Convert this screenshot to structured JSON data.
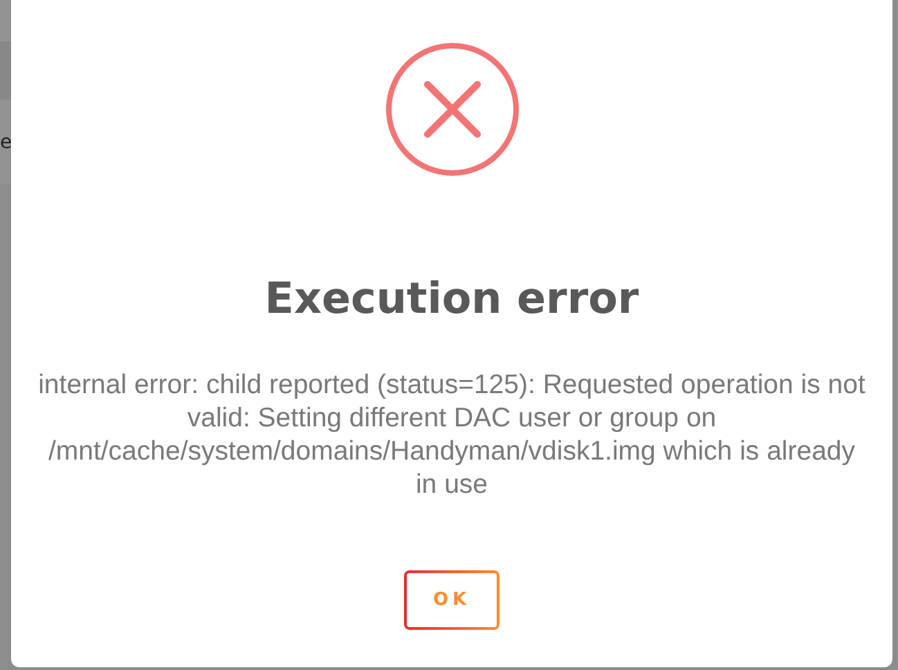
{
  "background": {
    "fragment": "e"
  },
  "dialog": {
    "kind": "error",
    "title": "Execution error",
    "message": "internal error: child reported (status=125): Requested operation is not valid: Setting different DAC user or group on /mnt/cache/system/domains/Handyman/vdisk1.img which is already in use",
    "buttons": [
      "OK"
    ]
  }
}
